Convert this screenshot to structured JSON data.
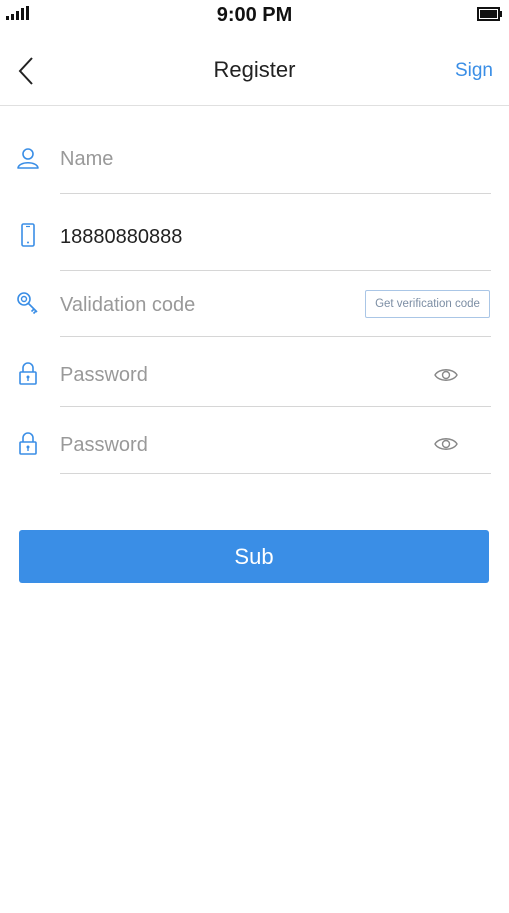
{
  "status_bar": {
    "time": "9:00 PM"
  },
  "nav": {
    "title": "Register",
    "right_link": "Sign"
  },
  "form": {
    "name": {
      "value": "",
      "placeholder": "Name"
    },
    "phone": {
      "value": "18880880888",
      "placeholder": ""
    },
    "code": {
      "value": "",
      "placeholder": "Validation code",
      "button_label": "Get verification code"
    },
    "password": {
      "value": "",
      "placeholder": "Password"
    },
    "confirm_password": {
      "value": "",
      "placeholder": "Password"
    }
  },
  "submit_label": "Sub",
  "colors": {
    "accent": "#3a8ee6",
    "divider": "#d6d6d6",
    "placeholder": "#999999"
  },
  "icons": [
    "signal-icon",
    "battery-icon",
    "back-arrow-icon",
    "user-icon",
    "phone-icon",
    "key-icon",
    "lock-icon",
    "eye-icon"
  ]
}
